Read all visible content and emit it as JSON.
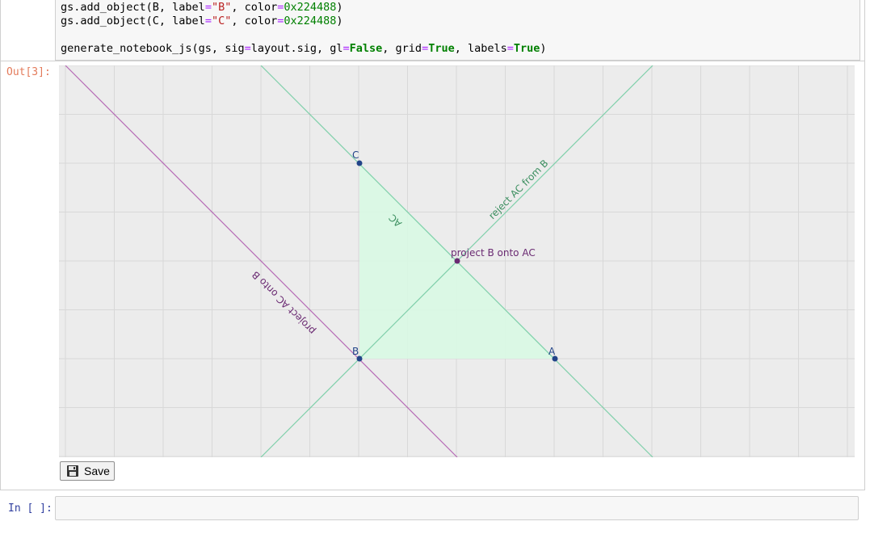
{
  "code": {
    "line1": {
      "a": "gs.add_object(B, label",
      "op1": "=",
      "str": "\"B\"",
      "b": ", color",
      "op2": "=",
      "num": "0x224488",
      "c": ")"
    },
    "line2": {
      "a": "gs.add_object(C, label",
      "op1": "=",
      "str": "\"C\"",
      "b": ", color",
      "op2": "=",
      "num": "0x224488",
      "c": ")"
    },
    "line3": {
      "a": "generate_notebook_js(gs, sig",
      "op1": "=",
      "b": "layout.sig, gl",
      "op2": "=",
      "kw1": "False",
      "c": ", grid",
      "op3": "=",
      "kw2": "True",
      "d": ", labels",
      "op4": "=",
      "kw3": "True",
      "e": ")"
    }
  },
  "output_prompt": "Out[3]:",
  "input_prompt": "In [ ]:",
  "save_label": "Save",
  "plot": {
    "colors": {
      "background": "#ececec",
      "grid": "#d8d8d8",
      "teal_line": "#7fcfaa",
      "magenta_line": "#b66bb6",
      "triangle_fill": "#d9f9e4",
      "point": "#224488",
      "purple_point": "#6a2a72"
    },
    "labels": {
      "A": "A",
      "B": "B",
      "C": "C",
      "AC": "AC",
      "project_B_onto_AC": "project B onto AC",
      "reject_AC_from_B": "reject AC from B",
      "project_AC_onto_B": "project AC onto B"
    }
  }
}
